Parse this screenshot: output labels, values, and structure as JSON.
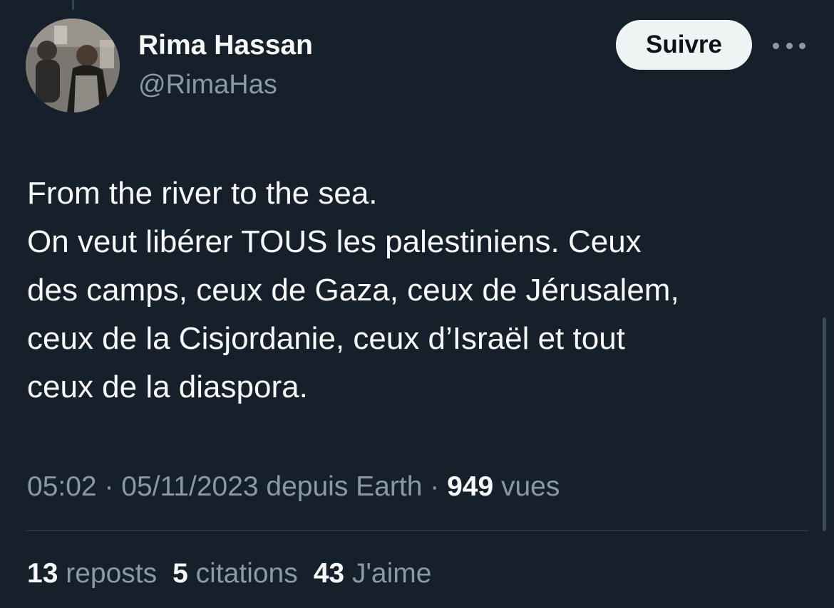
{
  "author": {
    "name": "Rima Hassan",
    "handle": "@RimaHas"
  },
  "actions": {
    "follow_label": "Suivre",
    "more_icon": "more-horizontal-icon"
  },
  "tweet": {
    "lines": [
      "From the river to the sea.",
      "On veut libérer TOUS les palestiniens. Ceux",
      "des camps, ceux de Gaza, ceux de Jérusalem,",
      "ceux de la Cisjordanie, ceux d’Israël et tout",
      "ceux de la diaspora."
    ]
  },
  "meta": {
    "time": "05:02",
    "separator": " · ",
    "date": "05/11/2023",
    "source": " depuis Earth",
    "views_count": "949",
    "views_label": " vues"
  },
  "stats": {
    "reposts": {
      "count": "13",
      "label": " reposts"
    },
    "quotes": {
      "count": "5",
      "label": " citations"
    },
    "likes": {
      "count": "43",
      "label": " J'aime"
    }
  },
  "colors": {
    "background": "#15202b",
    "primary_text": "#f7f9f9",
    "secondary_text": "#8b98a5",
    "follow_button_bg": "#eff3f4",
    "divider": "#38444d"
  }
}
